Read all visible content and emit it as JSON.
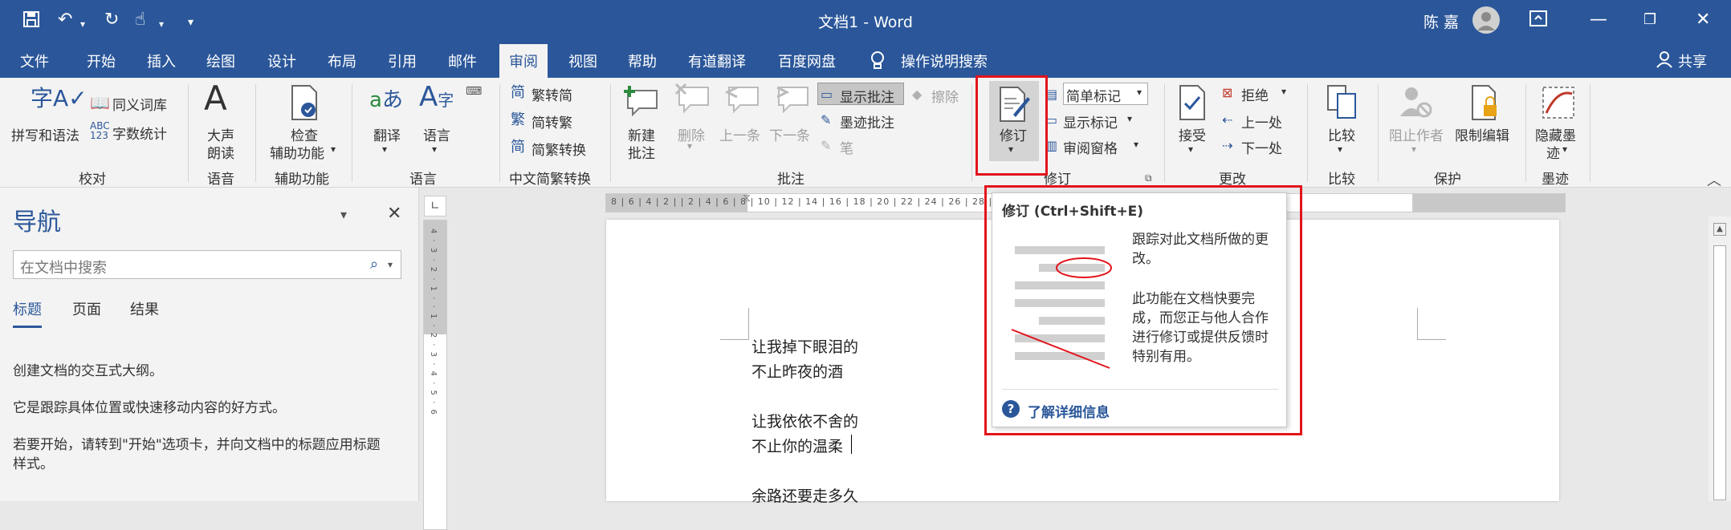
{
  "titlebar": {
    "title": "文档1  -  Word",
    "user_name": "陈 嘉",
    "more": "▾"
  },
  "menu": {
    "items": [
      "文件",
      "开始",
      "插入",
      "绘图",
      "设计",
      "布局",
      "引用",
      "邮件",
      "审阅",
      "视图",
      "帮助",
      "有道翻译",
      "百度网盘"
    ],
    "search_label": "操作说明搜索",
    "share_label": "共享"
  },
  "ribbon": {
    "proofing": {
      "spell": "拼写和语法",
      "thesaurus": "同义词库",
      "word_count": "字数统计",
      "group": "校对"
    },
    "speech": {
      "read_aloud_1": "大声",
      "read_aloud_2": "朗读",
      "group": "语音"
    },
    "accessibility": {
      "check_1": "检查",
      "check_2": "辅助功能",
      "group": "辅助功能"
    },
    "language": {
      "translate": "翻译",
      "language": "语言",
      "group": "语言"
    },
    "chinese": {
      "to_traditional": "繁转简",
      "to_simplified": "简转繁",
      "convert": "简繁转换",
      "group": "中文简繁转换"
    },
    "comments": {
      "new_1": "新建",
      "new_2": "批注",
      "delete": "删除",
      "previous": "上一条",
      "next": "下一条",
      "show": "显示批注",
      "erase": "擦除",
      "ink_review": "墨迹批注",
      "pen": "笔",
      "group": "批注"
    },
    "tracking": {
      "track_changes": "修订",
      "markup_select": "简单标记",
      "show_markup": "显示标记",
      "reviewing_pane": "审阅窗格",
      "group": "修订"
    },
    "changes": {
      "accept": "接受",
      "reject": "拒绝",
      "previous": "上一处",
      "next": "下一处",
      "group": "更改"
    },
    "compare": {
      "compare": "比较",
      "group": "比较"
    },
    "protect": {
      "block_authors": "阻止作者",
      "restrict": "限制编辑",
      "group": "保护"
    },
    "ink": {
      "hide_1": "隐藏墨",
      "hide_2": "迹",
      "group": "墨迹"
    }
  },
  "nav": {
    "title": "导航",
    "search_placeholder": "在文档中搜索",
    "tabs": [
      "标题",
      "页面",
      "结果"
    ],
    "text1": "创建文档的交互式大纲。",
    "text2": "它是跟踪具体位置或快速移动内容的好方式。",
    "text3a": "若要开始，请转到\"开始\"选项卡，并向文档中的标题应用标题",
    "text3b": "样式。"
  },
  "doc": {
    "lines": [
      "让我掉下眼泪的",
      "不止昨夜的酒",
      "让我依依不舍的",
      "不止你的温柔",
      "余路还要走多久"
    ]
  },
  "hruler": {
    "ticks": "8 | 6 | 4 | 2 |   | 2 | 4 | 6 | 8 | 10 | 12 | 14 | 16 | 18 | 20 | 22 | 24 | 26 | 28 | 30 | 32 | 34 | 36 | 38 | 40 | 42 | 44 | 46 | 48"
  },
  "vruler": {
    "ticks": "4 · 3 · 2 · 1 · · 1 · 2 · 3 · 4 · 5 · 6"
  },
  "tooltip": {
    "title": "修订 (Ctrl+Shift+E)",
    "desc1": "跟踪对此文档所做的更改。",
    "desc2": "此功能在文档快要完成，而您正与他人合作进行修订或提供反馈时特别有用。",
    "learn_more": "了解详细信息"
  },
  "colors": {
    "accent": "#2b579a",
    "highlight": "#e3141c"
  }
}
